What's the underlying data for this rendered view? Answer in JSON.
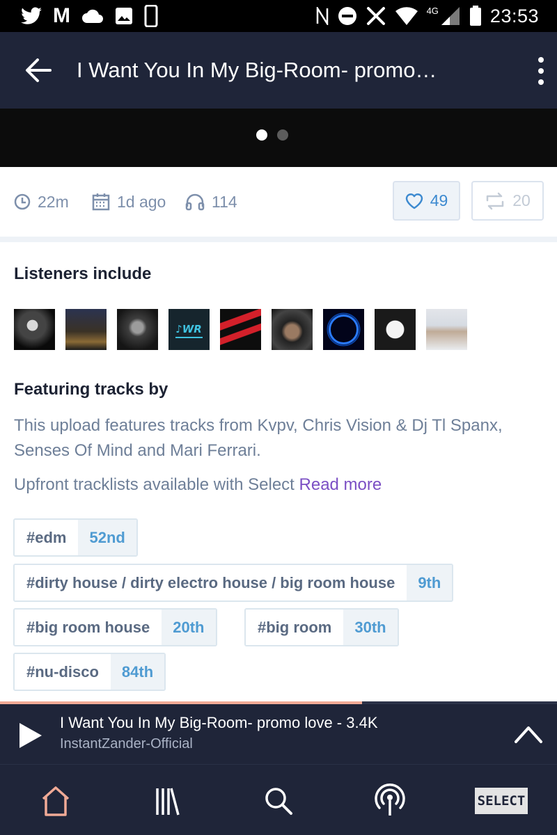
{
  "status_bar": {
    "time": "23:53",
    "network": "4G",
    "left_icons": [
      "twitter-icon",
      "gmail-icon",
      "cloud-icon",
      "image-icon",
      "phone-icon"
    ],
    "right_icons": [
      "nfc-icon",
      "do-not-disturb-icon",
      "tools-icon",
      "wifi-icon",
      "signal-icon",
      "battery-icon"
    ]
  },
  "app_bar": {
    "title": "I Want You In My Big-Room- promo…"
  },
  "carousel": {
    "pages": 2,
    "active_page": 1
  },
  "stats": {
    "duration": "22m",
    "uploaded": "1d ago",
    "listens": "114",
    "likes": "49",
    "reposts": "20"
  },
  "listeners": {
    "heading": "Listeners include",
    "avatar_count": 9
  },
  "featuring": {
    "heading": "Featuring tracks by",
    "text": "This upload features tracks from Kvpv, Chris Vision & Dj Tl Spanx, Senses Of Mind and Mari Ferrari.",
    "upsell": "Upfront tracklists available with Select",
    "read_more": "Read more"
  },
  "tags": [
    {
      "name": "#edm",
      "rank": "52nd"
    },
    {
      "name": "#dirty house / dirty electro house / big room house",
      "rank": "9th"
    },
    {
      "name": "#big room house",
      "rank": "20th"
    },
    {
      "name": "#big room",
      "rank": "30th"
    },
    {
      "name": "#nu-disco",
      "rank": "84th"
    }
  ],
  "player": {
    "title": "I Want You In My Big-Room- promo love - 3.4K",
    "artist": "InstantZander-Official",
    "progress": 0.65
  },
  "nav": {
    "items": [
      "home-icon",
      "library-icon",
      "search-icon",
      "live-icon"
    ],
    "select_label": "SELECT"
  },
  "colors": {
    "header_bg": "#1f2539",
    "accent_link": "#7b4fc4",
    "rank_blue": "#4f9bd2",
    "progress": "#f0aa96"
  }
}
